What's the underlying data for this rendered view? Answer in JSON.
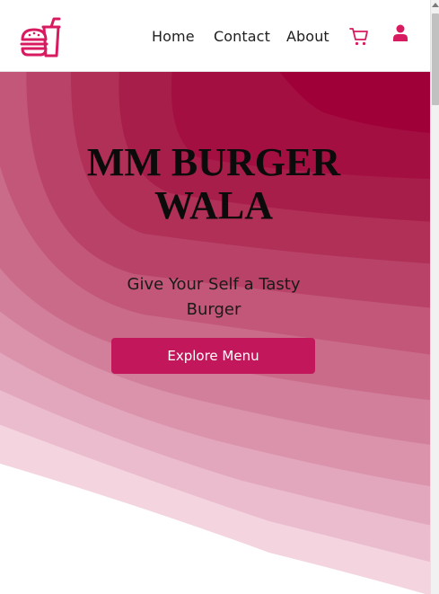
{
  "header": {
    "logo_icon": "burger-and-drink-logo-icon",
    "nav": [
      {
        "label": "Home"
      },
      {
        "label": "Contact"
      },
      {
        "label": "About"
      }
    ],
    "cart_icon": "cart-icon",
    "user_icon": "user-icon"
  },
  "hero": {
    "title": "MM BURGER WALA",
    "subtitle": "Give Your Self a Tasty Burger",
    "cta_label": "Explore Menu"
  },
  "colors": {
    "accent": "#c2185b",
    "hero_deep": "#a00038",
    "text": "#0b0b0b"
  }
}
